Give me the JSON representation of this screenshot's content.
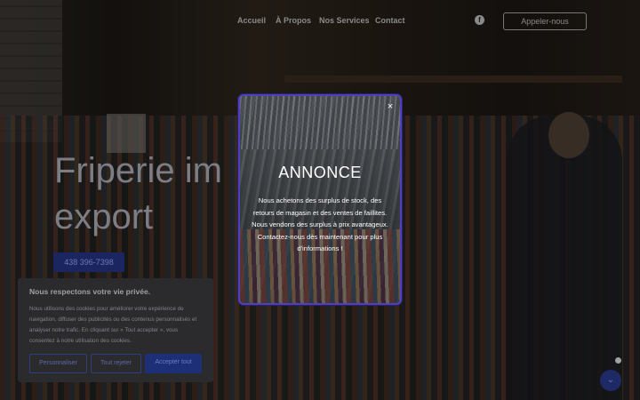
{
  "nav": {
    "links": [
      "Accueil",
      "À Propos",
      "Nos Services",
      "Contact"
    ],
    "facebook_icon": "facebook-icon",
    "call_button": "Appeler-nous"
  },
  "hero": {
    "title_line1": "Friperie im",
    "title_line2": "export",
    "phone": "438 396-7398"
  },
  "modal": {
    "close": "×",
    "title": "ANNONCE",
    "text": "Nous achetons des surplus de stock, des retours de magasin et des ventes de faillites. Nous vendons des surplus à prix avantageux. Contactez-nous dès maintenant pour plus d'informations !"
  },
  "cookie": {
    "title": "Nous respectons votre vie privée.",
    "text": "Nous utilisons des cookies pour améliorer votre expérience de navigation, diffuser des publicités ou des contenus personnalisés et analyser notre trafic. En cliquant sur « Tout accepter », vous consentez à notre utilisation des cookies.",
    "btn_customize": "Personnaliser",
    "btn_reject": "Tout rejeter",
    "btn_accept": "Accepter tout"
  },
  "scroll_icon": "chevron-down-icon",
  "colors": {
    "accent": "#1d2f77",
    "modal_border": "#4f3ec0"
  }
}
